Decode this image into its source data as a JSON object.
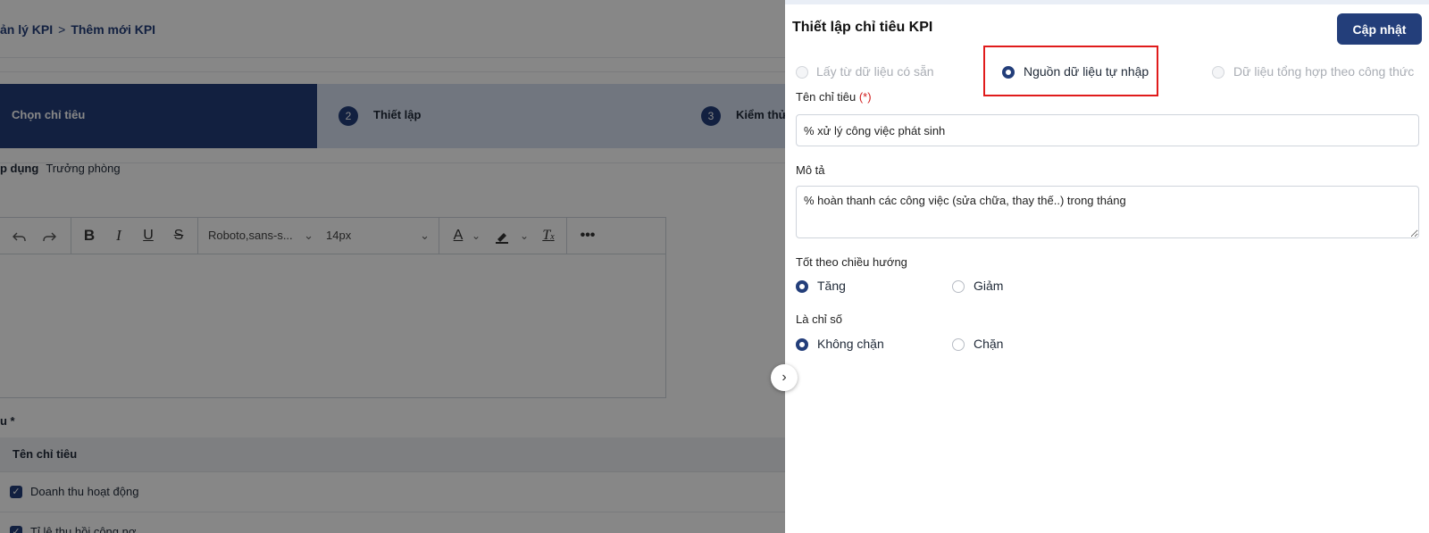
{
  "background": {
    "breadcrumb": {
      "parent": "ản lý KPI",
      "current": "Thêm mới KPI"
    },
    "steps": [
      {
        "number": "",
        "label": "Chọn chỉ tiêu"
      },
      {
        "number": "2",
        "label": "Thiết lập"
      },
      {
        "number": "3",
        "label": "Kiểm thử"
      }
    ],
    "apply": {
      "label": "p dụng",
      "value": "Trưởng phòng"
    },
    "editor": {
      "font_family": "Roboto,sans-s...",
      "font_size": "14px"
    },
    "criteria_label": "u *",
    "table": {
      "header": "Tên chỉ tiêu",
      "rows": [
        "Doanh thu hoạt động",
        "Tỉ lệ thu hồi công nợ"
      ]
    }
  },
  "panel": {
    "title": "Thiết lập chỉ tiêu KPI",
    "update_button": "Cập nhật",
    "source_options": [
      {
        "label": "Lấy từ dữ liệu có sẵn",
        "state": "disabled"
      },
      {
        "label": "Nguồn dữ liệu tự nhập",
        "state": "selected"
      },
      {
        "label": "Dữ liệu tổng hợp theo công thức",
        "state": "disabled"
      }
    ],
    "name_field": {
      "label": "Tên chỉ tiêu",
      "required_mark": "(*)",
      "value": "% xử lý công việc phát sinh"
    },
    "description_field": {
      "label": "Mô tả",
      "value": "% hoàn thanh các công việc (sửa chữa, thay thế..) trong tháng"
    },
    "direction": {
      "label": "Tốt theo chiều hướng",
      "options": [
        "Tăng",
        "Giảm"
      ],
      "selected": "Tăng"
    },
    "index_type": {
      "label": "Là chỉ số",
      "options": [
        "Không chặn",
        "Chặn"
      ],
      "selected": "Không chặn"
    }
  },
  "colors": {
    "primary": "#233e7a",
    "highlight_border": "#e01b1b",
    "required": "#d11d1d"
  },
  "icons": [
    "undo-icon",
    "redo-icon",
    "bold-icon",
    "italic-icon",
    "underline-icon",
    "strikethrough-icon",
    "text-color-icon",
    "highlight-icon",
    "clear-format-icon",
    "more-icon",
    "chevron-right-icon",
    "check-icon"
  ]
}
